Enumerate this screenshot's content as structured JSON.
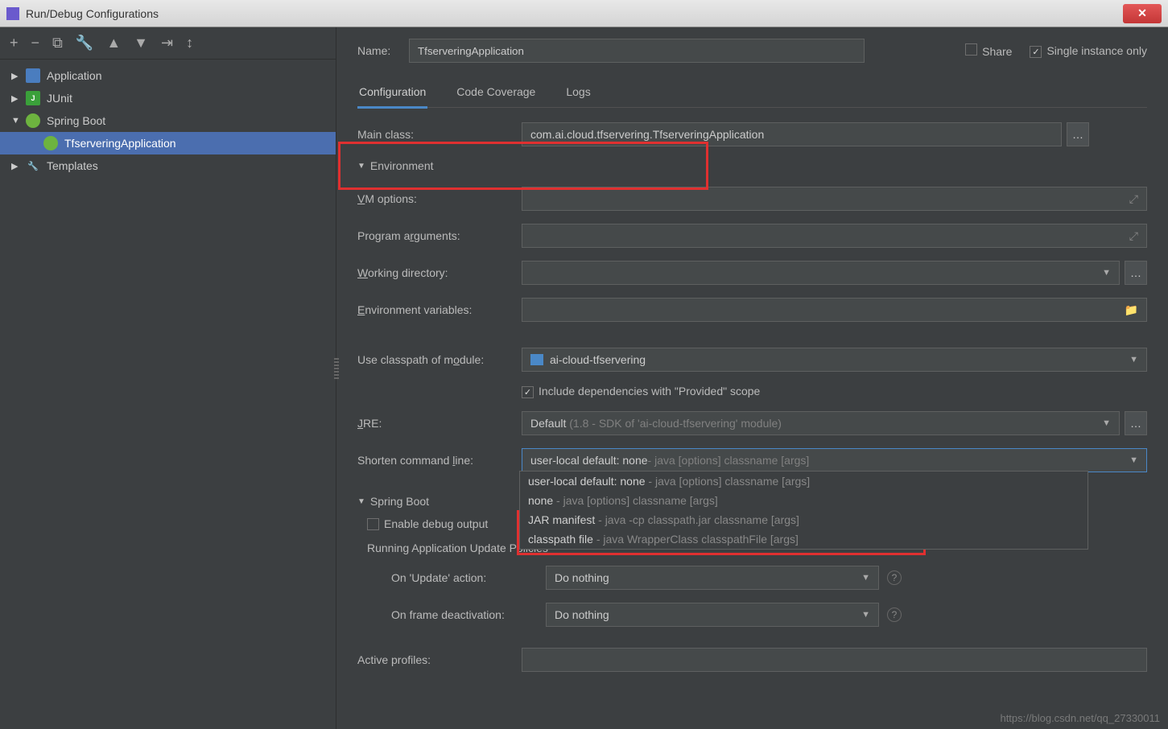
{
  "window": {
    "title": "Run/Debug Configurations"
  },
  "toolbar": {
    "add": "+",
    "remove": "−",
    "copy": "⧉",
    "wrench": "🔧",
    "up": "▲",
    "down": "▼",
    "export": "⇥",
    "sort": "↕"
  },
  "tree": {
    "items": [
      {
        "label": "Application",
        "icon": "app",
        "expand": "▶"
      },
      {
        "label": "JUnit",
        "icon": "junit",
        "iconText": "J",
        "expand": "▶"
      },
      {
        "label": "Spring Boot",
        "icon": "spring",
        "expand": "▼",
        "children": [
          {
            "label": "TfserveringApplication",
            "icon": "spring"
          }
        ]
      },
      {
        "label": "Templates",
        "icon": "wrench",
        "expand": "▶"
      }
    ]
  },
  "header": {
    "name_label": "Name:",
    "name_value": "TfserveringApplication",
    "share_label": "Share",
    "single_label": "Single instance only"
  },
  "tabs": {
    "config": "Configuration",
    "coverage": "Code Coverage",
    "logs": "Logs"
  },
  "form": {
    "main_class_label": "Main class:",
    "main_class_value": "com.ai.cloud.tfservering.TfserveringApplication",
    "environment_label": "Environment",
    "vm_label": "VM options:",
    "args_label": "Program arguments:",
    "workdir_label": "Working directory:",
    "envvars_label": "Environment variables:",
    "classpath_label": "Use classpath of module:",
    "classpath_value": "ai-cloud-tfservering",
    "include_deps_label": "Include dependencies with \"Provided\" scope",
    "jre_label": "JRE:",
    "jre_value_main": "Default",
    "jre_value_sub": "(1.8 - SDK of 'ai-cloud-tfservering' module)",
    "shorten_label": "Shorten command line:",
    "shorten_value_main": "user-local default: none",
    "shorten_value_sub": " - java [options] classname [args]",
    "springboot_label": "Spring Boot",
    "enable_debug_label": "Enable debug output",
    "running_update_label": "Running Application Update Policies",
    "on_update_label": "On 'Update' action:",
    "on_update_value": "Do nothing",
    "on_frame_label": "On frame deactivation:",
    "on_frame_value": "Do nothing",
    "active_profiles_label": "Active profiles:"
  },
  "shorten_options": [
    {
      "main": "user-local default: none",
      "sub": " - java [options] classname [args]"
    },
    {
      "main": "none",
      "sub": " - java [options] classname [args]"
    },
    {
      "main": "JAR manifest",
      "sub": " - java -cp classpath.jar classname [args]"
    },
    {
      "main": "classpath file",
      "sub": " - java WrapperClass classpathFile [args]"
    }
  ],
  "watermark": "https://blog.csdn.net/qq_27330011"
}
